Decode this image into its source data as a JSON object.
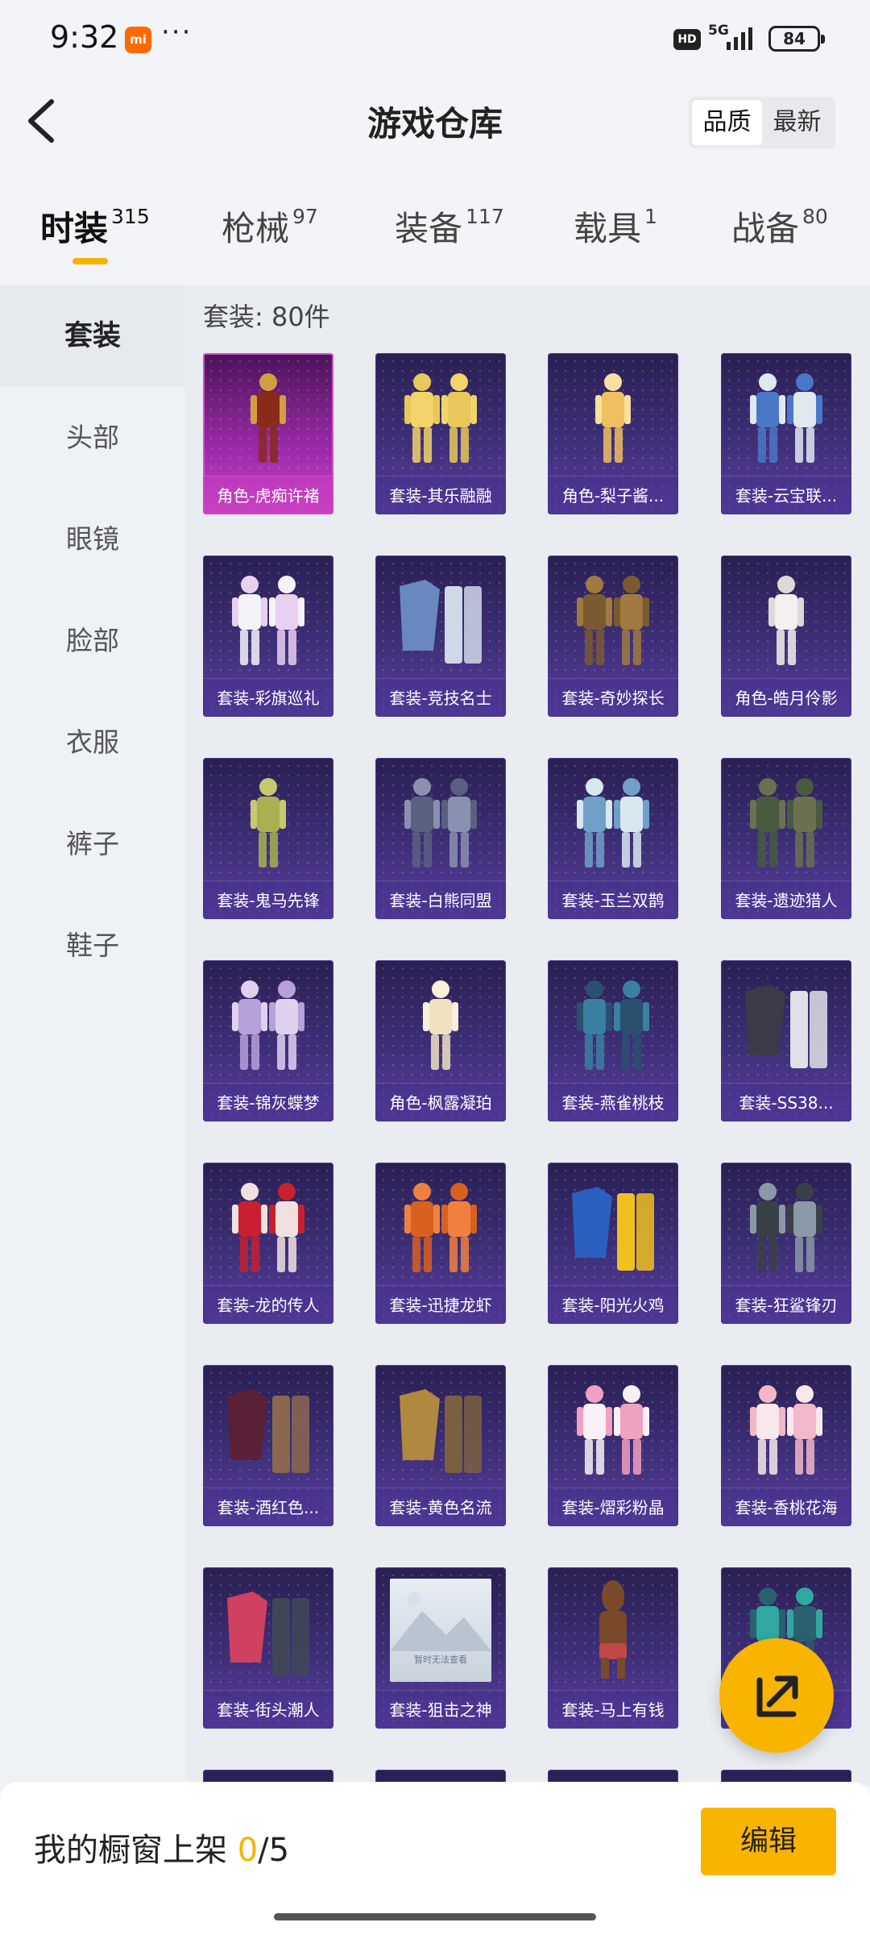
{
  "status_bar": {
    "time": "9:32",
    "app_badge": "mi",
    "overflow": "···",
    "hd": "HD",
    "network": "5G",
    "battery": "84"
  },
  "header": {
    "title": "游戏仓库",
    "sort_options": [
      {
        "label": "品质",
        "active": true
      },
      {
        "label": "最新",
        "active": false
      }
    ]
  },
  "category_tabs": [
    {
      "label": "时装",
      "count": "315",
      "active": true
    },
    {
      "label": "枪械",
      "count": "97",
      "active": false
    },
    {
      "label": "装备",
      "count": "117",
      "active": false
    },
    {
      "label": "载具",
      "count": "1",
      "active": false
    },
    {
      "label": "战备",
      "count": "80",
      "active": false
    }
  ],
  "sidebar": {
    "items": [
      {
        "label": "套装",
        "active": true
      },
      {
        "label": "头部",
        "active": false
      },
      {
        "label": "眼镜",
        "active": false
      },
      {
        "label": "脸部",
        "active": false
      },
      {
        "label": "衣服",
        "active": false
      },
      {
        "label": "裤子",
        "active": false
      },
      {
        "label": "鞋子",
        "active": false
      }
    ]
  },
  "content": {
    "section_count": "套装: 80件",
    "items": [
      {
        "name": "角色-虎痴许褚",
        "quality": "legendary",
        "figure": "warrior"
      },
      {
        "name": "套装-其乐融融",
        "quality": "epic",
        "figure": "duo-yellow"
      },
      {
        "name": "角色-梨子酱...",
        "quality": "epic",
        "figure": "girl-yellow"
      },
      {
        "name": "套装-云宝联...",
        "quality": "epic",
        "figure": "duo-blue"
      },
      {
        "name": "套装-彩旗巡礼",
        "quality": "epic",
        "figure": "duo-white"
      },
      {
        "name": "套装-竞技名士",
        "quality": "epic",
        "figure": "clothes-blue"
      },
      {
        "name": "套装-奇妙探长",
        "quality": "epic",
        "figure": "duo-brown"
      },
      {
        "name": "角色-皓月伶影",
        "quality": "epic",
        "figure": "girl-white"
      },
      {
        "name": "套装-鬼马先锋",
        "quality": "epic",
        "figure": "single-green"
      },
      {
        "name": "套装-白熊同盟",
        "quality": "epic",
        "figure": "duo-grey"
      },
      {
        "name": "套装-玉兰双鹊",
        "quality": "epic",
        "figure": "duo-teal"
      },
      {
        "name": "套装-遗迹猎人",
        "quality": "epic",
        "figure": "duo-olive"
      },
      {
        "name": "套装-锦灰蝶梦",
        "quality": "epic",
        "figure": "duo-lilac"
      },
      {
        "name": "角色-枫露凝珀",
        "quality": "epic",
        "figure": "girl-cream"
      },
      {
        "name": "套装-燕雀桃枝",
        "quality": "epic",
        "figure": "duo-cyan"
      },
      {
        "name": "套装-SS38...",
        "quality": "epic",
        "figure": "clothes-dark"
      },
      {
        "name": "套装-龙的传人",
        "quality": "epic",
        "figure": "duo-red"
      },
      {
        "name": "套装-迅捷龙虾",
        "quality": "epic",
        "figure": "duo-orange"
      },
      {
        "name": "套装-阳光火鸡",
        "quality": "epic",
        "figure": "clothes-yellow"
      },
      {
        "name": "套装-狂鲨锋刃",
        "quality": "epic",
        "figure": "duo-black"
      },
      {
        "name": "套装-酒红色...",
        "quality": "epic",
        "figure": "clothes-wine"
      },
      {
        "name": "套装-黄色名流",
        "quality": "epic",
        "figure": "clothes-tan"
      },
      {
        "name": "套装-熠彩粉晶",
        "quality": "epic",
        "figure": "duo-pink"
      },
      {
        "name": "套装-香桃花海",
        "quality": "epic",
        "figure": "duo-peach"
      },
      {
        "name": "套装-街头潮人",
        "quality": "epic",
        "figure": "clothes-pink"
      },
      {
        "name": "套装-狙击之神",
        "quality": "epic",
        "figure": "placeholder",
        "placeholder_text": "暂时无法查看"
      },
      {
        "name": "套装-马上有钱",
        "quality": "epic",
        "figure": "horse"
      },
      {
        "name": "套装-...影",
        "quality": "epic",
        "figure": "duo-teal2"
      }
    ]
  },
  "fab": {
    "icon": "share-icon"
  },
  "bottom_bar": {
    "label": "我的橱窗上架",
    "current": "0",
    "max": "/5",
    "edit_label": "编辑"
  },
  "colors": {
    "accent": "#f9b400",
    "legendary": "#c945c9",
    "epic": "#3e2f78"
  }
}
